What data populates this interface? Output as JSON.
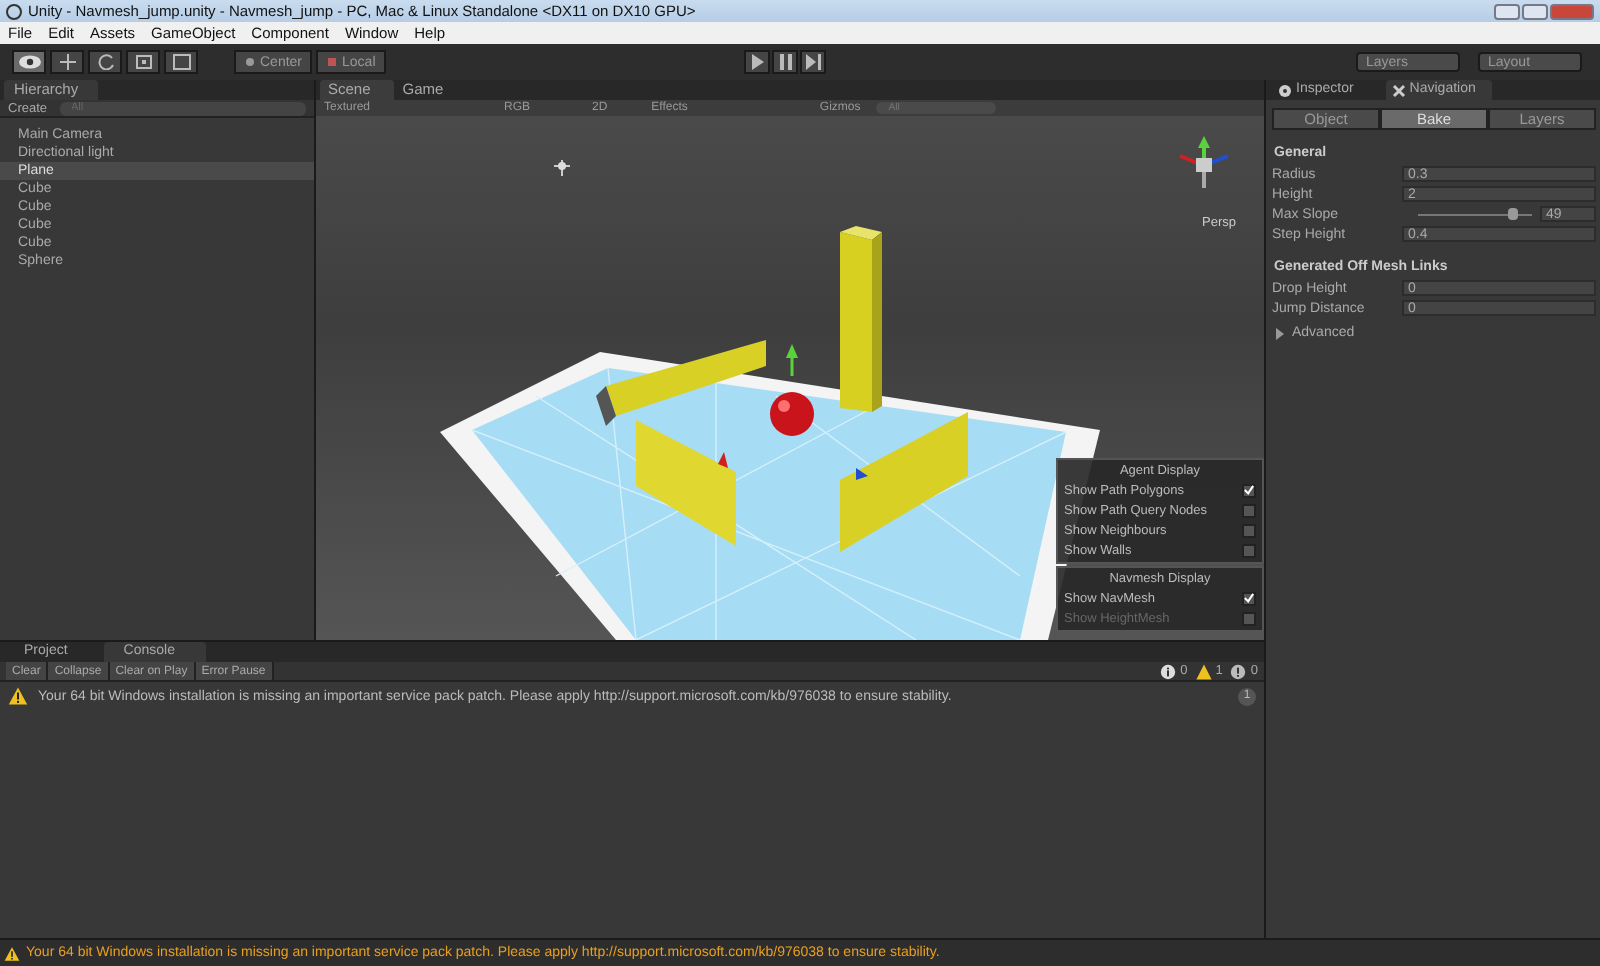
{
  "window": {
    "title": "Unity - Navmesh_jump.unity - Navmesh_jump - PC, Mac & Linux Standalone <DX11 on DX10 GPU>"
  },
  "menu": [
    "File",
    "Edit",
    "Assets",
    "GameObject",
    "Component",
    "Window",
    "Help"
  ],
  "toolbar": {
    "tools": [
      {
        "kind": "view",
        "selected": true
      },
      {
        "kind": "move",
        "selected": false
      },
      {
        "kind": "rotate",
        "selected": false
      },
      {
        "kind": "scale",
        "selected": false
      },
      {
        "kind": "rect",
        "selected": false
      }
    ],
    "pivot": "Center",
    "space": "Local",
    "layers": "Layers",
    "layout": "Layout"
  },
  "hierarchy": {
    "tab": "Hierarchy",
    "create": "Create",
    "search_placeholder": "All",
    "items": [
      {
        "label": "Main Camera",
        "selected": false
      },
      {
        "label": "Directional light",
        "selected": false
      },
      {
        "label": "Plane",
        "selected": true
      },
      {
        "label": "Cube",
        "selected": false
      },
      {
        "label": "Cube",
        "selected": false
      },
      {
        "label": "Cube",
        "selected": false
      },
      {
        "label": "Cube",
        "selected": false
      },
      {
        "label": "Sphere",
        "selected": false
      }
    ]
  },
  "scene": {
    "tabs": [
      {
        "label": "Scene",
        "selected": true
      },
      {
        "label": "Game",
        "selected": false
      }
    ],
    "toolbar": {
      "shading": "Textured",
      "render_mode": "RGB",
      "mode_2d": "2D",
      "effects": "Effects",
      "gizmos": "Gizmos",
      "search_placeholder": "All"
    },
    "persp": "Persp",
    "overlays": [
      {
        "title": "Agent Display",
        "options": [
          {
            "label": "Show Path Polygons",
            "checked": true,
            "disabled": false
          },
          {
            "label": "Show Path Query Nodes",
            "checked": false,
            "disabled": false
          },
          {
            "label": "Show Neighbours",
            "checked": false,
            "disabled": false
          },
          {
            "label": "Show Walls",
            "checked": false,
            "disabled": false
          }
        ]
      },
      {
        "title": "Navmesh Display",
        "options": [
          {
            "label": "Show NavMesh",
            "checked": true,
            "disabled": false
          },
          {
            "label": "Show HeightMesh",
            "checked": false,
            "disabled": true
          }
        ]
      }
    ]
  },
  "inspector": {
    "tabs": [
      {
        "label": "Inspector",
        "selected": false
      },
      {
        "label": "Navigation",
        "selected": true
      }
    ],
    "subtabs": [
      {
        "label": "Object",
        "selected": false
      },
      {
        "label": "Bake",
        "selected": true
      },
      {
        "label": "Layers",
        "selected": false
      }
    ],
    "sections": [
      {
        "title": "General",
        "fields": [
          {
            "kind": "number",
            "label": "Radius",
            "value": "0.3"
          },
          {
            "kind": "number",
            "label": "Height",
            "value": "2"
          },
          {
            "kind": "slider",
            "label": "Max Slope",
            "value": "49",
            "level": 0.82
          },
          {
            "kind": "number",
            "label": "Step Height",
            "value": "0.4"
          }
        ]
      },
      {
        "title": "Generated Off Mesh Links",
        "fields": [
          {
            "kind": "number",
            "label": "Drop Height",
            "value": "0"
          },
          {
            "kind": "number",
            "label": "Jump Distance",
            "value": "0"
          }
        ]
      }
    ],
    "advanced": {
      "label": "Advanced",
      "expanded": false
    }
  },
  "console": {
    "tabs": [
      {
        "label": "Project",
        "selected": false
      },
      {
        "label": "Console",
        "selected": true
      }
    ],
    "buttons": [
      "Clear",
      "Collapse",
      "Clear on Play",
      "Error Pause"
    ],
    "counters": [
      {
        "kind": "info",
        "value": "0"
      },
      {
        "kind": "warning",
        "value": "1"
      },
      {
        "kind": "error",
        "value": "0"
      }
    ],
    "messages": [
      {
        "kind": "warning",
        "text": "Your 64 bit Windows installation is missing an important service pack patch. Please apply http://support.microsoft.com/kb/976038 to ensure stability.",
        "count": "1"
      }
    ]
  },
  "status_bar": {
    "kind": "warning",
    "text": "Your 64 bit Windows installation is missing an important service pack patch. Please apply http://support.microsoft.com/kb/976038 to ensure stability."
  }
}
